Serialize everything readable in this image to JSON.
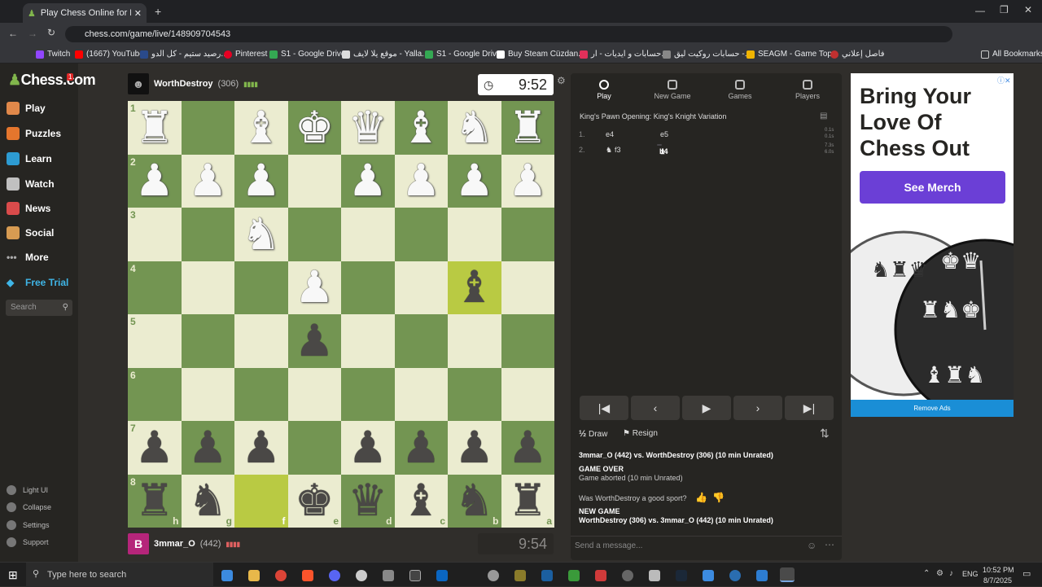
{
  "browser": {
    "tab_title": "Play Chess Online for FREE",
    "url": "chess.com/game/live/148909704543",
    "bookmarks": [
      "Twitch",
      "(1667) YouTube",
      "رصيد ستيم - كل الدو...",
      "Pinterest",
      "S1 - Google Drive",
      "موقع يلا لايف - Yalla...",
      "S1 - Google Drive",
      "Buy Steam Cüzdan...",
      "حسابات و ايديات - ار...",
      "حسابات روكيت ليق -...",
      "SEAGM - Game Top...",
      "فاصل إعلاني"
    ],
    "all_bookmarks": "All Bookmarks"
  },
  "sidebar": {
    "logo": "Chess.com",
    "notif_count": "1",
    "items": [
      {
        "label": "Play",
        "color": "#e0884a"
      },
      {
        "label": "Puzzles",
        "color": "#e5762d"
      },
      {
        "label": "Learn",
        "color": "#2d9bd2"
      },
      {
        "label": "Watch",
        "color": "#c0c0c0"
      },
      {
        "label": "News",
        "color": "#d94b4b"
      },
      {
        "label": "Social",
        "color": "#d79b52"
      },
      {
        "label": "More",
        "color": "#aaaaaa"
      },
      {
        "label": "Free Trial",
        "color": "#3fb5e6"
      }
    ],
    "search_placeholder": "Search",
    "bottom": [
      "Light UI",
      "Collapse",
      "Settings",
      "Support"
    ]
  },
  "game": {
    "top_player": {
      "name": "WorthDestroy",
      "rating": "(306)",
      "clock": "9:52"
    },
    "bottom_player": {
      "name": "3mmar_O",
      "rating": "(442)",
      "clock": "9:54",
      "avatar_letter": "B"
    },
    "board": [
      [
        "wR",
        "",
        "wB",
        "wK",
        "wQ",
        "wB",
        "wN",
        "wR"
      ],
      [
        "wP",
        "wP",
        "wP",
        "",
        "wP",
        "wP",
        "wP",
        "wP"
      ],
      [
        "",
        "",
        "wN",
        "",
        "",
        "",
        "",
        ""
      ],
      [
        "",
        "",
        "",
        "wP",
        "",
        "",
        "bB",
        ""
      ],
      [
        "",
        "",
        "",
        "bP",
        "",
        "",
        "",
        ""
      ],
      [
        "",
        "",
        "",
        "",
        "",
        "",
        "",
        ""
      ],
      [
        "bP",
        "bP",
        "bP",
        "",
        "bP",
        "bP",
        "bP",
        "bP"
      ],
      [
        "bR",
        "bN",
        "",
        "bK",
        "bQ",
        "bB",
        "bN",
        "bR"
      ]
    ],
    "ranks": [
      "1",
      "2",
      "3",
      "4",
      "5",
      "6",
      "7",
      "8"
    ],
    "files": [
      "h",
      "g",
      "f",
      "e",
      "d",
      "c",
      "b",
      "a"
    ]
  },
  "panel": {
    "tabs": [
      "Play",
      "New Game",
      "Games",
      "Players"
    ],
    "opening": "King's Pawn Opening: King's Knight Variation",
    "moves": [
      {
        "num": "1.",
        "white": "e4",
        "black": "e5",
        "t1": "0.1s",
        "t2": "0.1s"
      },
      {
        "num": "2.",
        "white": "f3",
        "black": "b4",
        "t1": "7.3s",
        "t2": "6.0s"
      }
    ],
    "draw": "Draw",
    "resign": "Resign",
    "chat": {
      "line1": "3mmar_O (442) vs. WorthDestroy (306) (10 min Unrated)",
      "game_over": "GAME OVER",
      "aborted": "Game aborted (10 min Unrated)",
      "good_sport": "Was WorthDestroy a good sport?",
      "new_game": "NEW GAME",
      "line2": "WorthDestroy (306) vs. 3mmar_O (442) (10 min Unrated)"
    },
    "message_placeholder": "Send a message..."
  },
  "ad": {
    "headline": "Bring Your Love Of Chess Out",
    "button": "See Merch",
    "remove": "Remove Ads"
  },
  "taskbar": {
    "search_placeholder": "Type here to search",
    "lang": "ENG",
    "time": "10:52 PM",
    "date": "8/7/2025"
  }
}
